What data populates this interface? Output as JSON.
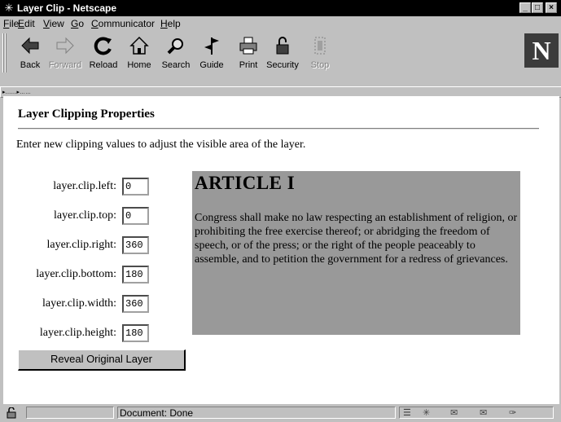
{
  "window": {
    "title": "Layer Clip - Netscape"
  },
  "menu": [
    {
      "label": "File",
      "hotkey": "F",
      "rest": "ile"
    },
    {
      "label": "Edit",
      "hotkey": "E",
      "rest": "dit"
    },
    {
      "label": "View",
      "hotkey": "V",
      "rest": "iew"
    },
    {
      "label": "Go",
      "hotkey": "G",
      "rest": "o"
    },
    {
      "label": "Communicator",
      "hotkey": "C",
      "rest": "ommunicator"
    },
    {
      "label": "Help",
      "hotkey": "H",
      "rest": "elp"
    }
  ],
  "toolbar": {
    "back": "Back",
    "forward": "Forward",
    "reload": "Reload",
    "home": "Home",
    "search": "Search",
    "guide": "Guide",
    "print": "Print",
    "security": "Security",
    "stop": "Stop"
  },
  "brand": {
    "logo_letter": "N"
  },
  "page": {
    "heading": "Layer Clipping Properties",
    "intro": "Enter new clipping values to adjust the visible area of the layer.",
    "fields": [
      {
        "label": "layer.clip.left:",
        "value": "0"
      },
      {
        "label": "layer.clip.top:",
        "value": "0"
      },
      {
        "label": "layer.clip.right:",
        "value": "360"
      },
      {
        "label": "layer.clip.bottom:",
        "value": "180"
      },
      {
        "label": "layer.clip.width:",
        "value": "360"
      },
      {
        "label": "layer.clip.height:",
        "value": "180"
      }
    ],
    "reveal_button": "Reveal Original Layer",
    "article": {
      "title": "ARTICLE I",
      "text": "Congress shall make no law respecting an establishment of religion, or prohibiting the free exercise thereof; or abridging the freedom of speech, or of the press; or the right of the people peaceably to assemble, and to petition the government for a redress of grievances."
    }
  },
  "status": {
    "text": "Document: Done"
  },
  "colors": {
    "title_bar": "#000000",
    "chrome": "#c0c0c0",
    "layer_bg": "#999999"
  }
}
